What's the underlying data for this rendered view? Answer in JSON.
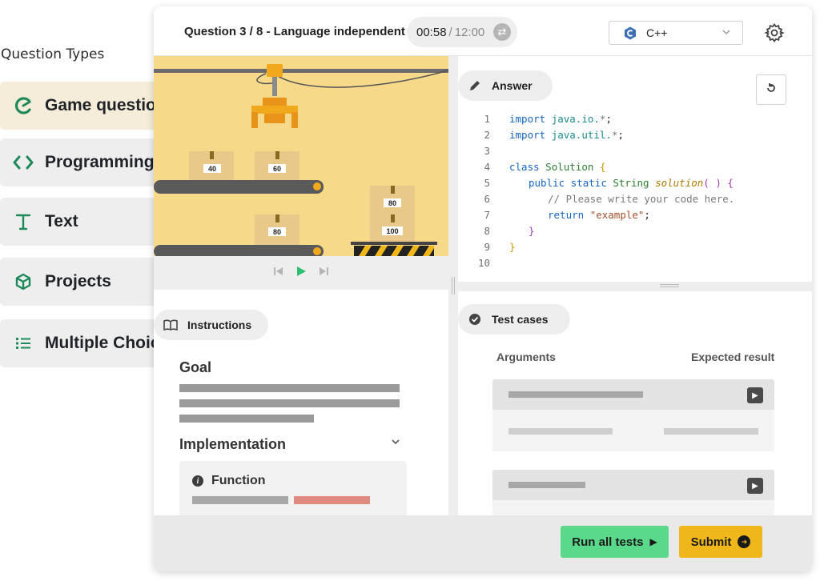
{
  "question_types": {
    "title": "Question Types",
    "items": [
      {
        "label": "Game questions",
        "icon": "pacman-icon"
      },
      {
        "label": "Programming",
        "icon": "code-brackets-icon"
      },
      {
        "label": "Text",
        "icon": "text-t-icon"
      },
      {
        "label": "Projects",
        "icon": "cube-icon"
      },
      {
        "label": "Multiple Choic",
        "icon": "list-icon"
      }
    ]
  },
  "header": {
    "question_label": "Question 3 / 8 - Language independent",
    "timer_current": "00:58",
    "timer_separator": "/",
    "timer_total": "12:00",
    "language": "C++",
    "language_icon": "cpp-logo-icon"
  },
  "game": {
    "boxes": [
      "40",
      "60",
      "80",
      "80",
      "100"
    ]
  },
  "panels": {
    "answer_label": "Answer",
    "instructions_label": "Instructions",
    "test_cases_label": "Test cases"
  },
  "instructions": {
    "goal_heading": "Goal",
    "implementation_heading": "Implementation",
    "function_label": "Function"
  },
  "code": {
    "line_numbers": [
      "1",
      "2",
      "3",
      "4",
      "5",
      "6",
      "7",
      "8",
      "9",
      "10"
    ]
  },
  "test_cases": {
    "arguments_header": "Arguments",
    "expected_header": "Expected result"
  },
  "actions": {
    "run_all": "Run all tests",
    "submit": "Submit"
  },
  "colors": {
    "accent_green": "#1e8a5a",
    "run_button": "#5ad98a",
    "submit_button": "#f0b71b",
    "game_background": "#f7d98a",
    "highlight_bar": "#e0897e"
  }
}
